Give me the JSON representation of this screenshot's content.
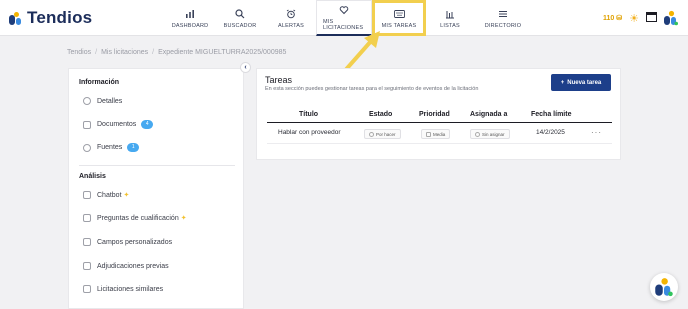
{
  "app": {
    "name": "Tendios"
  },
  "nav": {
    "dashboard": "DASHBOARD",
    "buscador": "BUSCADOR",
    "alertas": "ALERTAS",
    "mis_licitaciones": "MIS LICITACIONES",
    "mis_tareas": "MIS TAREAS",
    "listas": "LISTAS",
    "directorio": "DIRECTORIO"
  },
  "header_tools": {
    "credits": "110"
  },
  "breadcrumb": [
    "Tendios",
    "Mis licitaciones",
    "Expediente MIGUELTURRA2025/000985"
  ],
  "sidebar": {
    "info_title": "Información",
    "info_items": [
      {
        "label": "Detalles"
      },
      {
        "label": "Documentos",
        "badge": "4"
      },
      {
        "label": "Fuentes",
        "badge": "1"
      }
    ],
    "analysis_title": "Análisis",
    "analysis_items": [
      {
        "label": "Chatbot"
      },
      {
        "label": "Preguntas de cualificación"
      },
      {
        "label": "Campos personalizados"
      },
      {
        "label": "Adjudicaciones previas"
      },
      {
        "label": "Licitaciones similares"
      }
    ]
  },
  "tasks": {
    "title": "Tareas",
    "subtitle": "En esta sección puedes gestionar tareas para el seguimiento de eventos de la licitación",
    "new_button": "Nueva tarea",
    "columns": [
      "Título",
      "Estado",
      "Prioridad",
      "Asignada a",
      "Fecha límite"
    ],
    "rows": [
      {
        "titulo": "Hablar con proveedor",
        "estado": "Por hacer",
        "prioridad": "Media",
        "asignada": "Sin asignar",
        "fecha": "14/2/2025"
      }
    ]
  },
  "colors": {
    "brand_navy": "#1c2d5a",
    "primary_button": "#1d3f8a",
    "highlight": "#f2cf4e",
    "badge": "#47a9f0"
  }
}
